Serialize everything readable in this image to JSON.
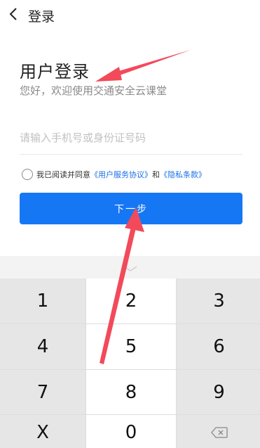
{
  "header": {
    "back_icon": "chevron-left-icon",
    "title": "登录"
  },
  "login": {
    "title": "用户登录",
    "subtitle": "您好，欢迎使用交通安全云课堂"
  },
  "phone_input": {
    "placeholder": "请输入手机号或身份证号码",
    "value": ""
  },
  "agreement": {
    "checked": false,
    "prefix": "我已阅读并同意",
    "user_agreement": "《用户服务协议》",
    "conjunction": "和",
    "privacy_policy": "《隐私条款》"
  },
  "next_button": {
    "label": "下一步"
  },
  "keyboard": {
    "collapse_icon": "chevron-down-icon",
    "keys": [
      "1",
      "2",
      "3",
      "4",
      "5",
      "6",
      "7",
      "8",
      "9",
      "X",
      "0"
    ],
    "backspace_icon": "backspace-icon"
  },
  "colors": {
    "primary": "#1677f5",
    "link": "#1a6fe8",
    "annotation": "#f24a5a"
  }
}
